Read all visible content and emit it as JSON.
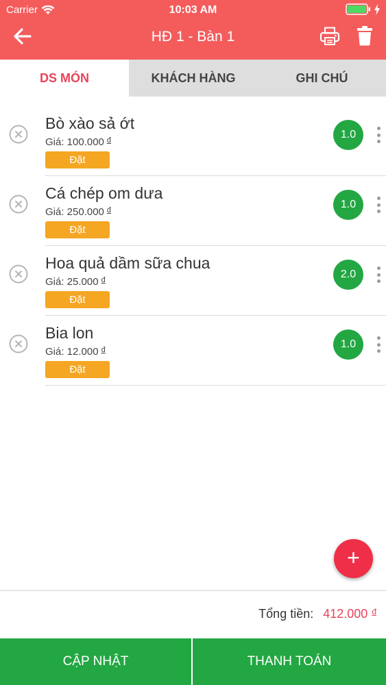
{
  "status_bar": {
    "carrier": "Carrier",
    "time": "10:03 AM"
  },
  "nav": {
    "title": "HĐ 1 - Bàn 1"
  },
  "tabs": [
    {
      "label": "DS MÓN",
      "active": true
    },
    {
      "label": "KHÁCH HÀNG",
      "active": false
    },
    {
      "label": "GHI CHÚ",
      "active": false
    }
  ],
  "items": [
    {
      "name": "Bò xào sả ớt",
      "price": "Giá: 100.000",
      "currency": "đ",
      "order_label": "Đặt",
      "qty": "1.0"
    },
    {
      "name": "Cá chép om dưa",
      "price": "Giá: 250.000",
      "currency": "đ",
      "order_label": "Đặt",
      "qty": "1.0"
    },
    {
      "name": "Hoa quả dầm sữa chua",
      "price": "Giá: 25.000",
      "currency": "đ",
      "order_label": "Đặt",
      "qty": "2.0"
    },
    {
      "name": "Bia lon",
      "price": "Giá: 12.000",
      "currency": "đ",
      "order_label": "Đặt",
      "qty": "1.0"
    }
  ],
  "fab": {
    "label": "+"
  },
  "total": {
    "label": "Tổng tiền:",
    "value": "412.000",
    "currency": "đ"
  },
  "buttons": {
    "update": "CẬP NHẬT",
    "pay": "THANH TOÁN"
  },
  "colors": {
    "header": "#f45c5c",
    "accent": "#e8435a",
    "green": "#23a743",
    "orange": "#f5a623",
    "fab": "#ee2f47"
  },
  "icons": {
    "back": "arrow-left-icon",
    "print": "printer-icon",
    "delete": "trash-icon",
    "remove": "close-circle-icon",
    "more": "more-vertical-icon"
  }
}
